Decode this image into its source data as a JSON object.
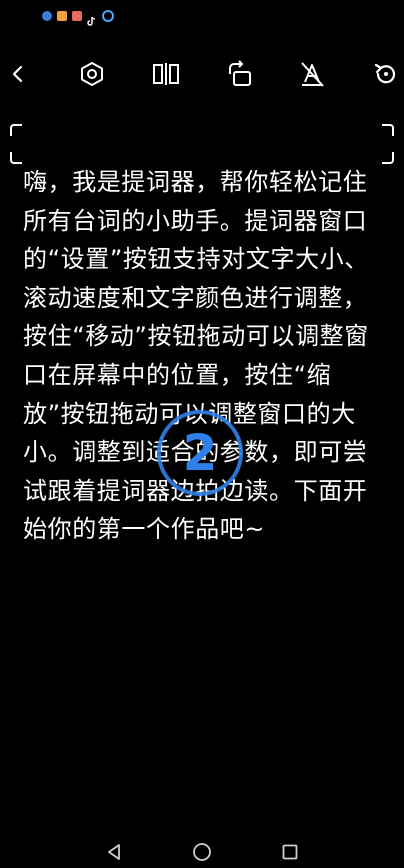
{
  "status_bar": {
    "icons": [
      "shield-app-icon",
      "orange-app-icon",
      "photo-app-icon",
      "tiktok-icon",
      "settings-app-icon"
    ]
  },
  "toolbar": {
    "items": [
      "back-icon",
      "settings-icon",
      "mirror-icon",
      "rotate-icon",
      "font-color-off-icon",
      "reset-icon"
    ]
  },
  "script": {
    "text": "嗨，我是提词器，帮你轻松记住所有台词的小助手。提词器窗口的“设置”按钮支持对文字大小、滚动速度和文字颜色进行调整，按住“移动”按钮拖动可以调整窗口在屏幕中的位置，按住“缩放”按钮拖动可以调整窗口的大小。调整到适合的参数，即可尝试跟着提词器边拍边读。下面开始你的第一个作品吧~"
  },
  "step_badge": {
    "number": "2",
    "color": "#2f7fe8"
  },
  "nav_bar": {
    "items": [
      "back-triangle-icon",
      "home-circle-icon",
      "recents-square-icon"
    ]
  },
  "colors": {
    "background": "#000000",
    "text": "#ffffff",
    "accent": "#2f7fe8"
  }
}
